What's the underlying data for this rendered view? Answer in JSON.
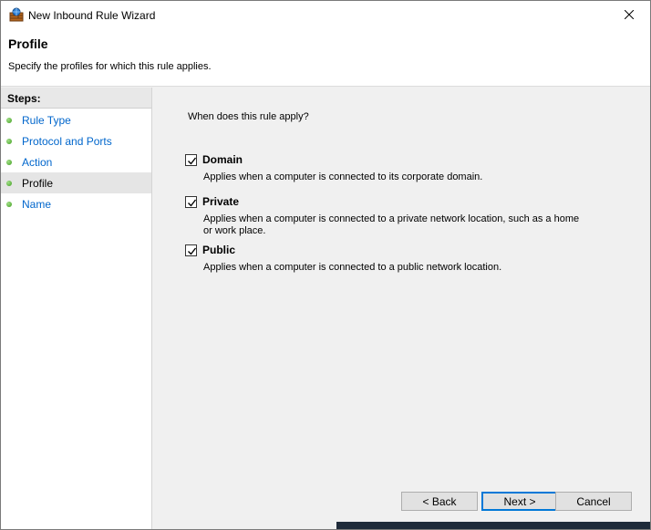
{
  "window": {
    "title": "New Inbound Rule Wizard",
    "close_glyph": "✕"
  },
  "header": {
    "title": "Profile",
    "description": "Specify the profiles for which this rule applies."
  },
  "steps": {
    "heading": "Steps:",
    "items": [
      {
        "label": "Rule Type"
      },
      {
        "label": "Protocol and Ports"
      },
      {
        "label": "Action"
      },
      {
        "label": "Profile"
      },
      {
        "label": "Name"
      }
    ],
    "current_index": 3
  },
  "content": {
    "question": "When does this rule apply?",
    "options": [
      {
        "title": "Domain",
        "description": "Applies when a computer is connected to its corporate domain.",
        "checked": true
      },
      {
        "title": "Private",
        "description": "Applies when a computer is connected to a private network location, such as a home or work place.",
        "checked": true
      },
      {
        "title": "Public",
        "description": "Applies when a computer is connected to a public network location.",
        "checked": true
      }
    ]
  },
  "buttons": {
    "back": "< Back",
    "next": "Next >",
    "cancel": "Cancel"
  },
  "colors": {
    "link": "#0066cc",
    "default_button_border": "#0078d7",
    "step_dot": "#3c9c1c"
  }
}
